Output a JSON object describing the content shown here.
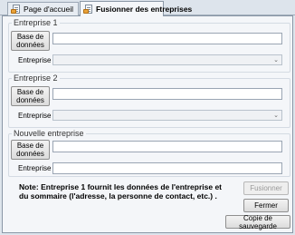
{
  "tabs": [
    {
      "label": "Page d'accueil",
      "active": false
    },
    {
      "label": "Fusionner des entreprises",
      "active": true
    }
  ],
  "groups": [
    {
      "title": "Entreprise 1",
      "db_button_line1": "Base de",
      "db_button_line2": "données",
      "db_value": "",
      "company_label": "Entreprise",
      "company_value": ""
    },
    {
      "title": "Entreprise 2",
      "db_button_line1": "Base de",
      "db_button_line2": "données",
      "db_value": "",
      "company_label": "Entreprise",
      "company_value": ""
    },
    {
      "title": "Nouvelle entreprise",
      "db_button_line1": "Base de",
      "db_button_line2": "données",
      "db_value": "",
      "company_label": "Entreprise",
      "company_value": ""
    }
  ],
  "note": "Note: Entreprise 1 fournit les données de l'entreprise et du sommaire (l'adresse, la personne de contact, etc.) .",
  "buttons": {
    "merge": "Fusionner",
    "close": "Fermer",
    "backup": "Copie de sauvegarde"
  }
}
